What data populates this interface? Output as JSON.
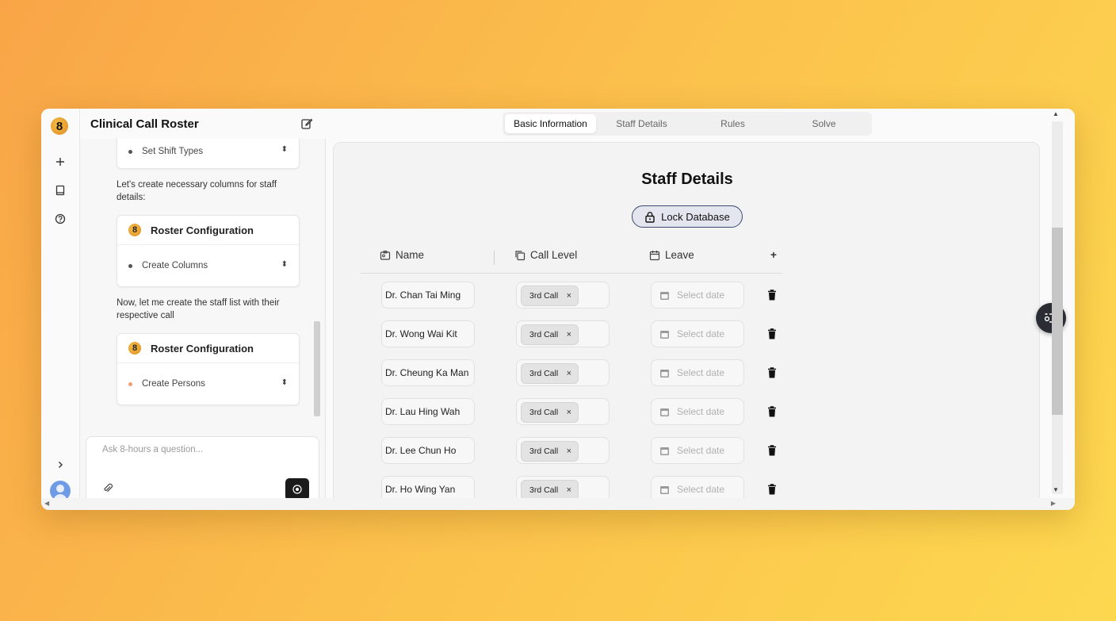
{
  "app": {
    "title": "Clinical Call Roster",
    "logo_glyph": "8"
  },
  "rail": {
    "icons": [
      "plus-icon",
      "book-icon",
      "help-icon",
      "chevron-right-icon",
      "user-avatar-icon"
    ]
  },
  "chat": {
    "top_card_item": "Set Shift Types",
    "message1": "Let's create necessary columns for staff details:",
    "card1": {
      "title": "Roster Configuration",
      "item": "Create Columns"
    },
    "message2": "Now, let me create the staff list with their respective call",
    "card2": {
      "title": "Roster Configuration",
      "item": "Create Persons"
    },
    "input_placeholder": "Ask 8-hours a question..."
  },
  "tabs": [
    {
      "label": "Basic Information",
      "active": true
    },
    {
      "label": "Staff Details",
      "active": false
    },
    {
      "label": "Rules",
      "active": false
    },
    {
      "label": "Solve",
      "active": false
    }
  ],
  "main": {
    "heading": "Staff Details",
    "lock_label": "Lock Database",
    "columns": {
      "name": "Name",
      "call_level": "Call Level",
      "leave": "Leave",
      "add": "+"
    },
    "date_placeholder": "Select date",
    "chip_remove": "×"
  },
  "staff": [
    {
      "name": "Dr. Chan Tai Ming",
      "call": "3rd Call"
    },
    {
      "name": "Dr. Wong Wai Kit",
      "call": "3rd Call"
    },
    {
      "name": "Dr. Cheung Ka Man",
      "call": "3rd Call"
    },
    {
      "name": "Dr. Lau Hing Wah",
      "call": "3rd Call"
    },
    {
      "name": "Dr. Lee Chun Ho",
      "call": "3rd Call"
    },
    {
      "name": "Dr. Ho Wing Yan",
      "call": "3rd Call"
    }
  ],
  "colors": {
    "accent_dark": "#1b1b1b",
    "lock_border": "#3c4a6b",
    "background_gradient_start": "#f9a547",
    "background_gradient_end": "#fdd84f"
  }
}
